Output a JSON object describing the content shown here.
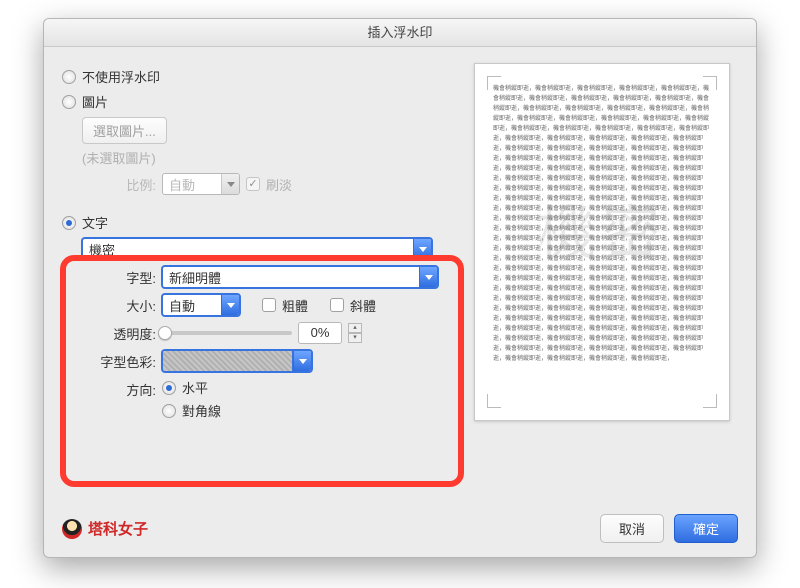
{
  "title": "插入浮水印",
  "options": {
    "none_label": "不使用浮水印",
    "picture_label": "圖片",
    "picture_choose": "選取圖片...",
    "picture_status": "(未選取圖片)",
    "scale_label": "比例:",
    "scale_value": "自動",
    "washout_label": "刷淡",
    "text_label": "文字",
    "text_value": "機密",
    "font_label": "字型:",
    "font_value": "新細明體",
    "size_label": "大小:",
    "size_value": "自動",
    "bold_label": "粗體",
    "italic_label": "斜體",
    "opacity_label": "透明度:",
    "opacity_value": "0%",
    "color_label": "字型色彩:",
    "direction_label": "方向:",
    "dir_horizontal": "水平",
    "dir_diagonal": "對角線"
  },
  "preview": {
    "watermark_text": "機密",
    "filler": "機會稍縱即逝，"
  },
  "footer": {
    "brand": "塔科女子",
    "cancel": "取消",
    "ok": "確定"
  }
}
